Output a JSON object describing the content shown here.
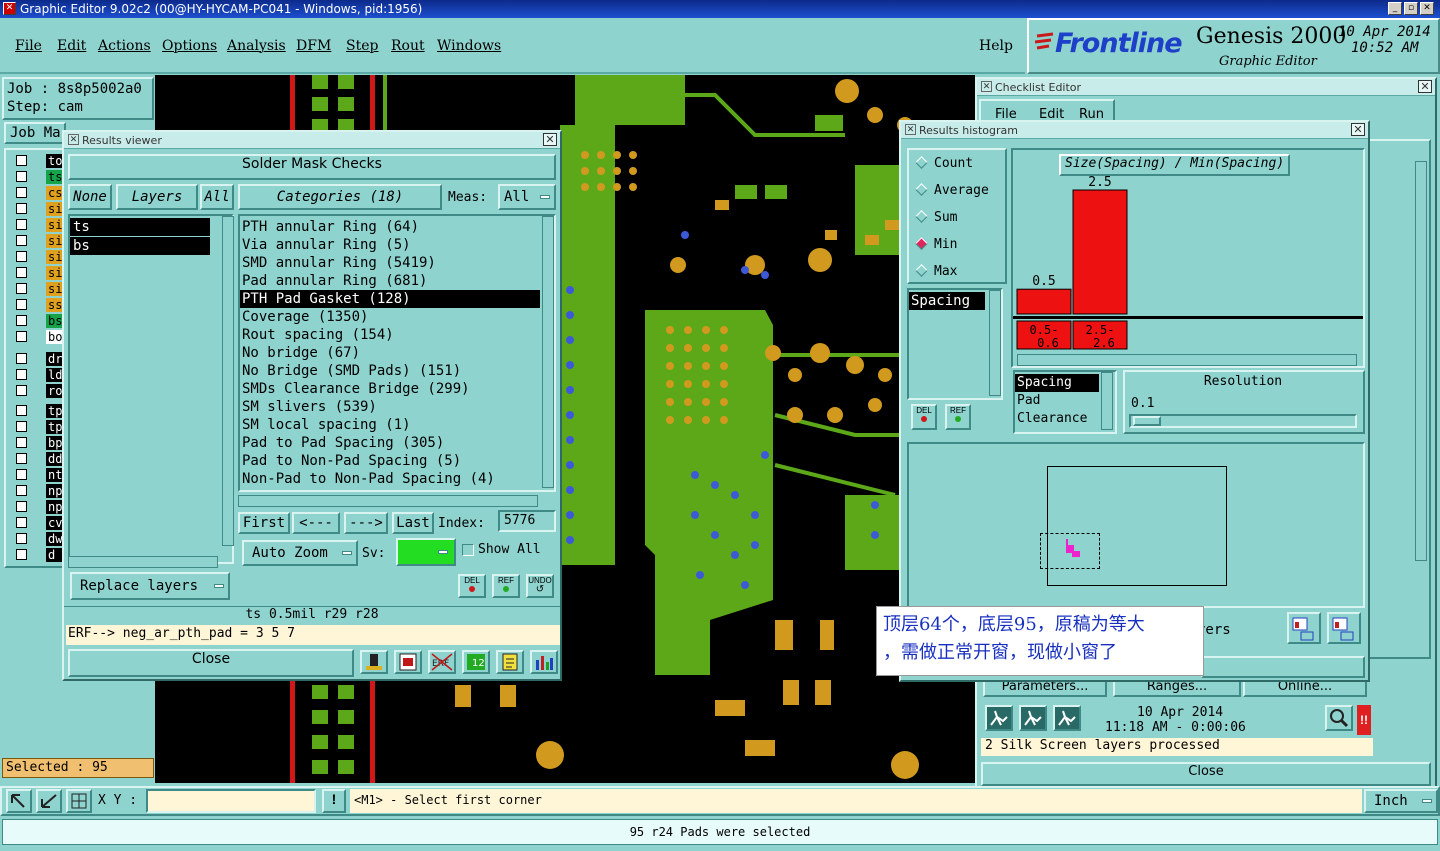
{
  "window_title": "Graphic Editor 9.02c2 (00@HY-HYCAM-PC041 - Windows, pid:1956)",
  "menu": [
    "File",
    "Edit",
    "Actions",
    "Options",
    "Analysis",
    "DFM",
    "Step",
    "Rout",
    "Windows"
  ],
  "help": "Help",
  "brand": {
    "logo": "Frontline",
    "product": "Genesis 2000",
    "subtitle": "Graphic Editor",
    "date": "10 Apr 2014",
    "time": "10:52 AM"
  },
  "job": {
    "job": "Job : 8s8p5002a0",
    "step": "Step: cam",
    "matrix": "Job Ma"
  },
  "layer_list": [
    {
      "name": "to",
      "color": "#000000",
      "text": "#ffffff"
    },
    {
      "name": "ts",
      "color": "#16a34a",
      "text": "#000000"
    },
    {
      "name": "cs",
      "color": "#e0a020",
      "text": "#000000"
    },
    {
      "name": "sic",
      "color": "#e0a020",
      "text": "#000000"
    },
    {
      "name": "sic",
      "color": "#e0a020",
      "text": "#000000"
    },
    {
      "name": "sic",
      "color": "#e0a020",
      "text": "#000000"
    },
    {
      "name": "sic",
      "color": "#e0a020",
      "text": "#000000"
    },
    {
      "name": "sic",
      "color": "#e0a020",
      "text": "#000000"
    },
    {
      "name": "sic",
      "color": "#e0a020",
      "text": "#000000"
    },
    {
      "name": "ss",
      "color": "#e0a020",
      "text": "#000000"
    },
    {
      "name": "bs",
      "color": "#16a34a",
      "text": "#000000"
    },
    {
      "name": "bo",
      "color": "#ffffff",
      "text": "#000000"
    },
    {
      "name": "drl",
      "color": "#000000",
      "text": "#ffffff"
    },
    {
      "name": "ldi",
      "color": "#000000",
      "text": "#ffffff"
    },
    {
      "name": "rou",
      "color": "#000000",
      "text": "#ffffff"
    },
    {
      "name": "tpt",
      "color": "#000000",
      "text": "#ffffff"
    },
    {
      "name": "tp",
      "color": "#000000",
      "text": "#ffffff"
    },
    {
      "name": "bp",
      "color": "#000000",
      "text": "#ffffff"
    },
    {
      "name": "dd",
      "color": "#000000",
      "text": "#ffffff"
    },
    {
      "name": "ntl",
      "color": "#000000",
      "text": "#ffffff"
    },
    {
      "name": "npt",
      "color": "#000000",
      "text": "#ffffff"
    },
    {
      "name": "npt",
      "color": "#000000",
      "text": "#ffffff"
    },
    {
      "name": "cvi",
      "color": "#000000",
      "text": "#ffffff"
    },
    {
      "name": "dwl",
      "color": "#000000",
      "text": "#ffffff"
    },
    {
      "name": "d",
      "color": "#000000",
      "text": "#ffffff"
    }
  ],
  "selected": "Selected : 95",
  "results_viewer": {
    "title": "Results viewer",
    "header": "Solder Mask Checks",
    "none": "None",
    "layers": "Layers",
    "all": "All",
    "categories": "Categories (18)",
    "meas_label": "Meas:",
    "meas_value": "All",
    "layer_items": [
      "ts",
      "bs"
    ],
    "category_items": [
      "PTH annular Ring (64)",
      "Via annular Ring (5)",
      "SMD annular Ring (5419)",
      "Pad annular Ring (681)",
      "PTH Pad Gasket (128)",
      "Coverage (1350)",
      "Rout spacing (154)",
      "No bridge (67)",
      "No Bridge (SMD Pads) (151)",
      "SMDs Clearance Bridge (299)",
      "SM slivers (539)",
      "SM local spacing (1)",
      "Pad to Pad Spacing (305)",
      "Pad to Non-Pad Spacing (5)",
      "Non-Pad to Non-Pad Spacing (4)"
    ],
    "selected_category": "PTH Pad Gasket (128)",
    "first": "First",
    "prev": "<---",
    "next": "--->",
    "last": "Last",
    "index_label": "Index:",
    "index_value": "5776",
    "auto_zoom": "Auto Zoom",
    "sv_label": "Sv:",
    "show_all": "Show All",
    "replace_layers": "Replace layers",
    "del": "DEL",
    "ref": "REF",
    "undo": "UNDO",
    "info_line": "ts 0.5mil   r29   r28",
    "erf_line": "ERF--> neg_ar_pth_pad = 3 5 7",
    "close": "Close"
  },
  "checklist_editor": {
    "title": "Checklist Editor",
    "menu": [
      "File",
      "Edit",
      "Run"
    ],
    "buttons": [
      "Parameters...",
      "Ranges...",
      "Online..."
    ],
    "date": "10 Apr 2014",
    "time": "11:18 AM - 0:00:06",
    "status": "2 Silk Screen layers processed",
    "close": "Close",
    "layers_frag": "yers"
  },
  "histogram": {
    "title": "Results histogram",
    "modes": [
      "Count",
      "Average",
      "Sum",
      "Min",
      "Max"
    ],
    "selected_mode": "Min",
    "left_list": [
      "Spacing"
    ],
    "del": "DEL",
    "ref": "REF",
    "chart_title": "Size(Spacing) / Min(Spacing)",
    "bars": [
      {
        "label": "0.5- 0.6",
        "value": 0.5
      },
      {
        "label": "2.5- 2.6",
        "value": 2.5
      }
    ],
    "bottom_list": [
      "Spacing",
      "Pad",
      "Clearance"
    ],
    "resolution_label": "Resolution",
    "resolution_value": "0.1"
  },
  "note_cn": {
    "line1": "顶层64个，底层95，原稿为等大",
    "line2": "，需做正常开窗，现做小窗了"
  },
  "bottom": {
    "xy_label": "X Y :",
    "prompt": "<M1> - Select first corner",
    "units": "Inch",
    "status": "95 r24 Pads were selected"
  },
  "colors": {
    "pcb_bg": "#000000",
    "copper": "#5ca818",
    "pad": "#d19a1f",
    "drill": "#3c5ad8",
    "trace_red": "#d01818",
    "hist_bar": "#ee1111"
  }
}
